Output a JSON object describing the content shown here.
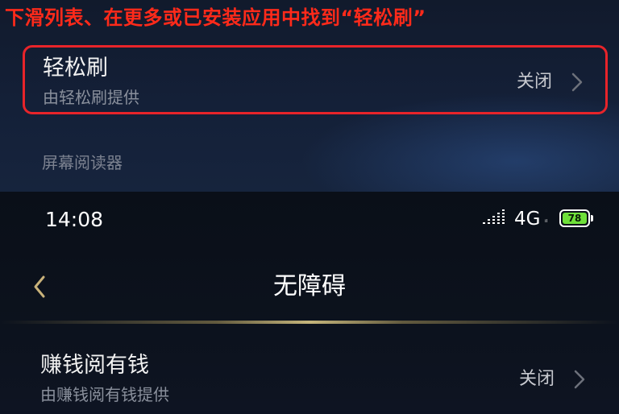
{
  "instruction": "下滑列表、在更多或已安装应用中找到“轻松刷”",
  "top_screen": {
    "highlighted_row": {
      "title": "轻松刷",
      "subtitle": "由轻松刷提供",
      "status": "关闭"
    },
    "section_header": "屏幕阅读器"
  },
  "bottom_screen": {
    "status_bar": {
      "time": "14:08",
      "network": "4G",
      "network_sub": "ᵢₗ",
      "battery_level": "78"
    },
    "nav": {
      "title": "无障碍"
    },
    "row": {
      "title": "赚钱阅有钱",
      "subtitle": "由赚钱阅有钱提供",
      "status": "关闭"
    }
  },
  "colors": {
    "instruction_text": "#ff2a1a",
    "highlight_border": "#e8242a",
    "battery_fill": "#6fe03a",
    "back_arrow": "#c9b27a"
  },
  "icons": {
    "chevron": "chevron-right-icon",
    "back": "chevron-left-icon",
    "signal": "signal-icon",
    "battery": "battery-icon"
  }
}
